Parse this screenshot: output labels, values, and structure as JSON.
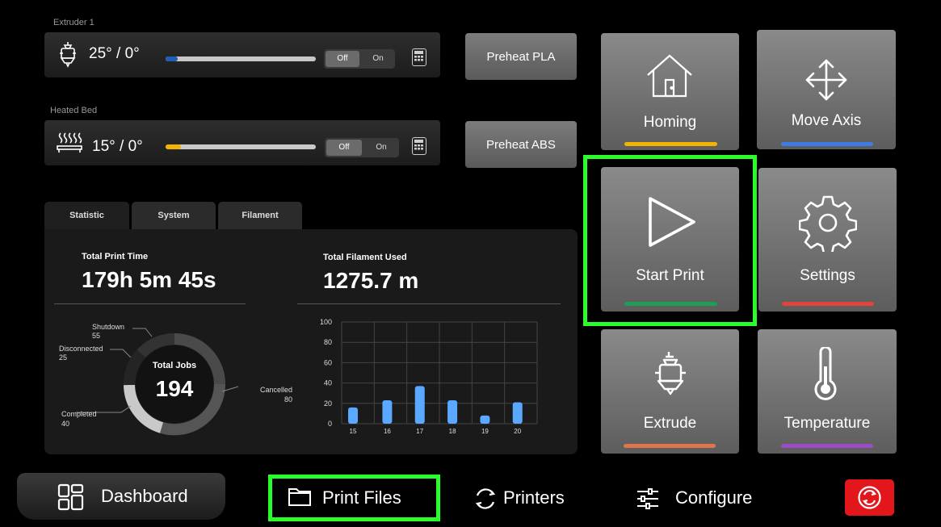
{
  "extruder": {
    "section_label": "Extruder 1",
    "temp": "25° / 0°",
    "off": "Off",
    "on": "On",
    "fill_fraction": 0.08,
    "fill_color": "#1e5fb3"
  },
  "bed": {
    "section_label": "Heated Bed",
    "temp": "15° / 0°",
    "off": "Off",
    "on": "On",
    "fill_fraction": 0.1,
    "fill_color": "#f2b400"
  },
  "preheat": {
    "pla": "Preheat PLA",
    "abs": "Preheat ABS"
  },
  "tabs": [
    {
      "label": "Statistic"
    },
    {
      "label": "System"
    },
    {
      "label": "Filament"
    }
  ],
  "stats": {
    "print_time_label": "Total Print Time",
    "print_time_value": "179h 5m 45s",
    "filament_label": "Total Filament Used",
    "filament_value": "1275.7 m",
    "jobs_label": "Total Jobs",
    "jobs_value": "194"
  },
  "donut": {
    "shutdown_label": "Shutdown",
    "shutdown_value": "55",
    "disconnected_label": "Disconnected",
    "disconnected_value": "25",
    "completed_label": "Completed",
    "completed_value": "40",
    "cancelled_label": "Cancelled",
    "cancelled_value": "80"
  },
  "chart_data": {
    "type": "bar",
    "categories": [
      "15",
      "16",
      "17",
      "18",
      "19",
      "20"
    ],
    "values": [
      16,
      23,
      37,
      23,
      8,
      21
    ],
    "ylim": [
      0,
      100
    ],
    "yticks": [
      "0",
      "20",
      "40",
      "60",
      "80",
      "100"
    ],
    "bar_color": "#5aa8ff",
    "grid": true
  },
  "tiles": [
    {
      "label": "Homing",
      "accent": "#f2b400",
      "icon": "home-icon"
    },
    {
      "label": "Move Axis",
      "accent": "#3e7be6",
      "icon": "move-arrows-icon"
    },
    {
      "label": "Start Print",
      "accent": "#1f9d55",
      "icon": "play-icon"
    },
    {
      "label": "Settings",
      "accent": "#e0443a",
      "icon": "gear-icon"
    },
    {
      "label": "Extrude",
      "accent": "#e0744a",
      "icon": "extruder-icon"
    },
    {
      "label": "Temperature",
      "accent": "#9b4bc8",
      "icon": "thermometer-icon"
    }
  ],
  "nav": {
    "dashboard": "Dashboard",
    "print_files": "Print Files",
    "printers": "Printers",
    "configure": "Configure",
    "emergency_color": "#e3161b"
  }
}
